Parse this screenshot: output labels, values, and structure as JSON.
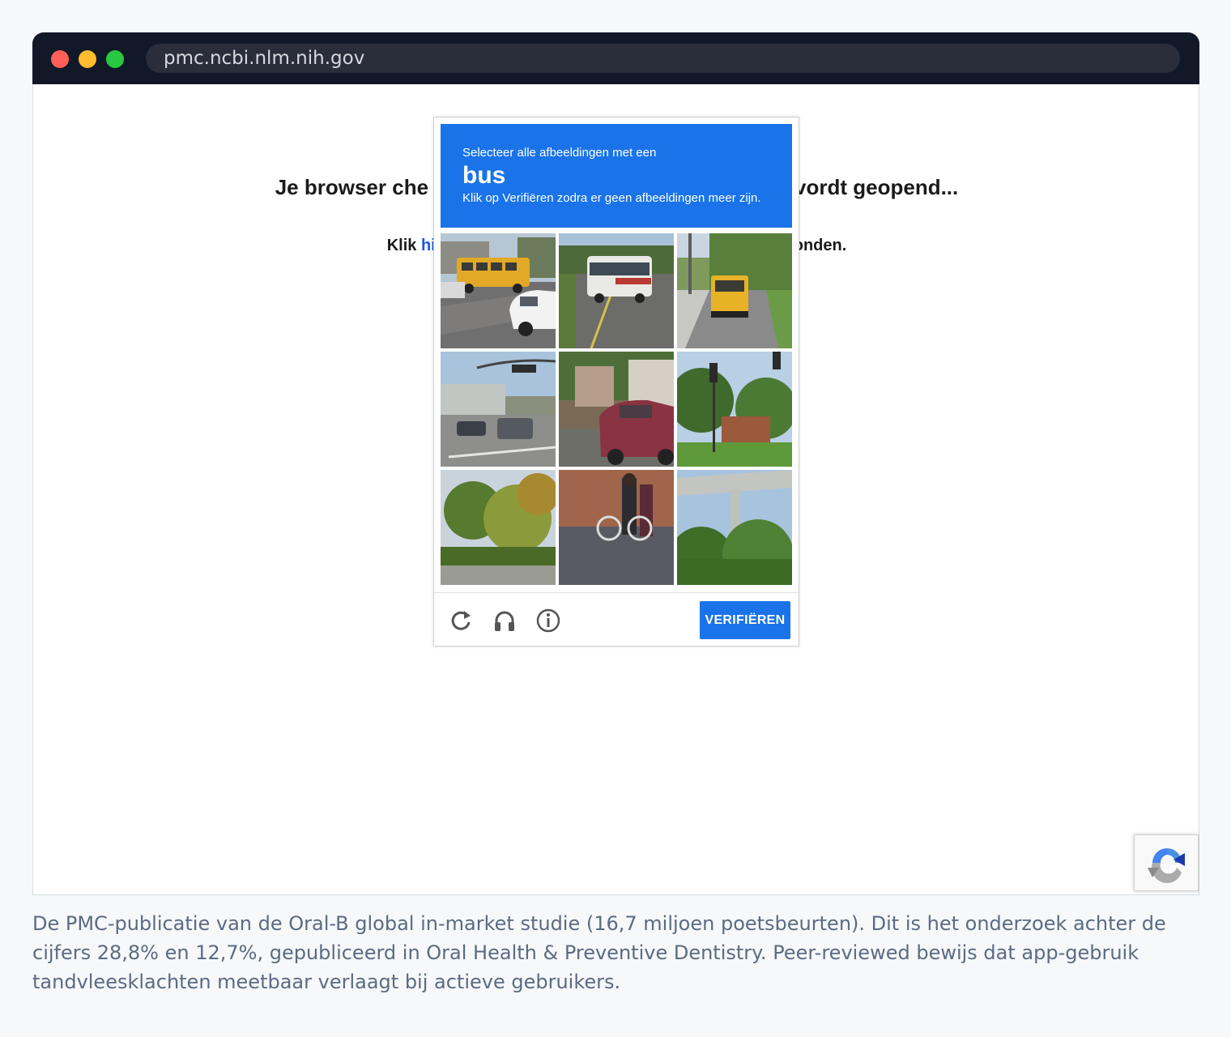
{
  "browser": {
    "url": "pmc.ncbi.nlm.nih.gov"
  },
  "page": {
    "heading_left": "Je browser che",
    "heading_right": "vordt geopend...",
    "click_prefix": "Klik ",
    "click_link": "hier",
    "click_suffix": "conden."
  },
  "captcha": {
    "instruction": "Selecteer alle afbeeldingen met een",
    "target_word": "bus",
    "hint": "Klik op Verifiëren zodra er geen afbeeldingen meer zijn.",
    "tiles": [
      {
        "row": 1,
        "col": 1,
        "content": "school bus at intersection with white van"
      },
      {
        "row": 1,
        "col": 2,
        "content": "city bus on road"
      },
      {
        "row": 1,
        "col": 3,
        "content": "school bus on residential road"
      },
      {
        "row": 2,
        "col": 1,
        "content": "intersection with traffic light and cars"
      },
      {
        "row": 2,
        "col": 2,
        "content": "red car parked near house"
      },
      {
        "row": 2,
        "col": 3,
        "content": "traffic light and trees"
      },
      {
        "row": 3,
        "col": 1,
        "content": "palm trees"
      },
      {
        "row": 3,
        "col": 2,
        "content": "people with bicycle near fence"
      },
      {
        "row": 3,
        "col": 3,
        "content": "highway overpass above trees"
      }
    ],
    "footer_icons": [
      "reload-icon",
      "headphones-icon",
      "info-icon"
    ],
    "verify_label": "VERIFIËREN",
    "accent_color": "#1a73e8"
  },
  "caption": "De PMC-publicatie van de Oral-B global in-market studie (16,7 miljoen poetsbeurten). Dit is het onderzoek achter de cijfers 28,8% en 12,7%, gepubliceerd in Oral Health & Preventive Dentistry. Peer-reviewed bewijs dat app-gebruik tandvleesklachten meetbaar verlaagt bij actieve gebruikers."
}
